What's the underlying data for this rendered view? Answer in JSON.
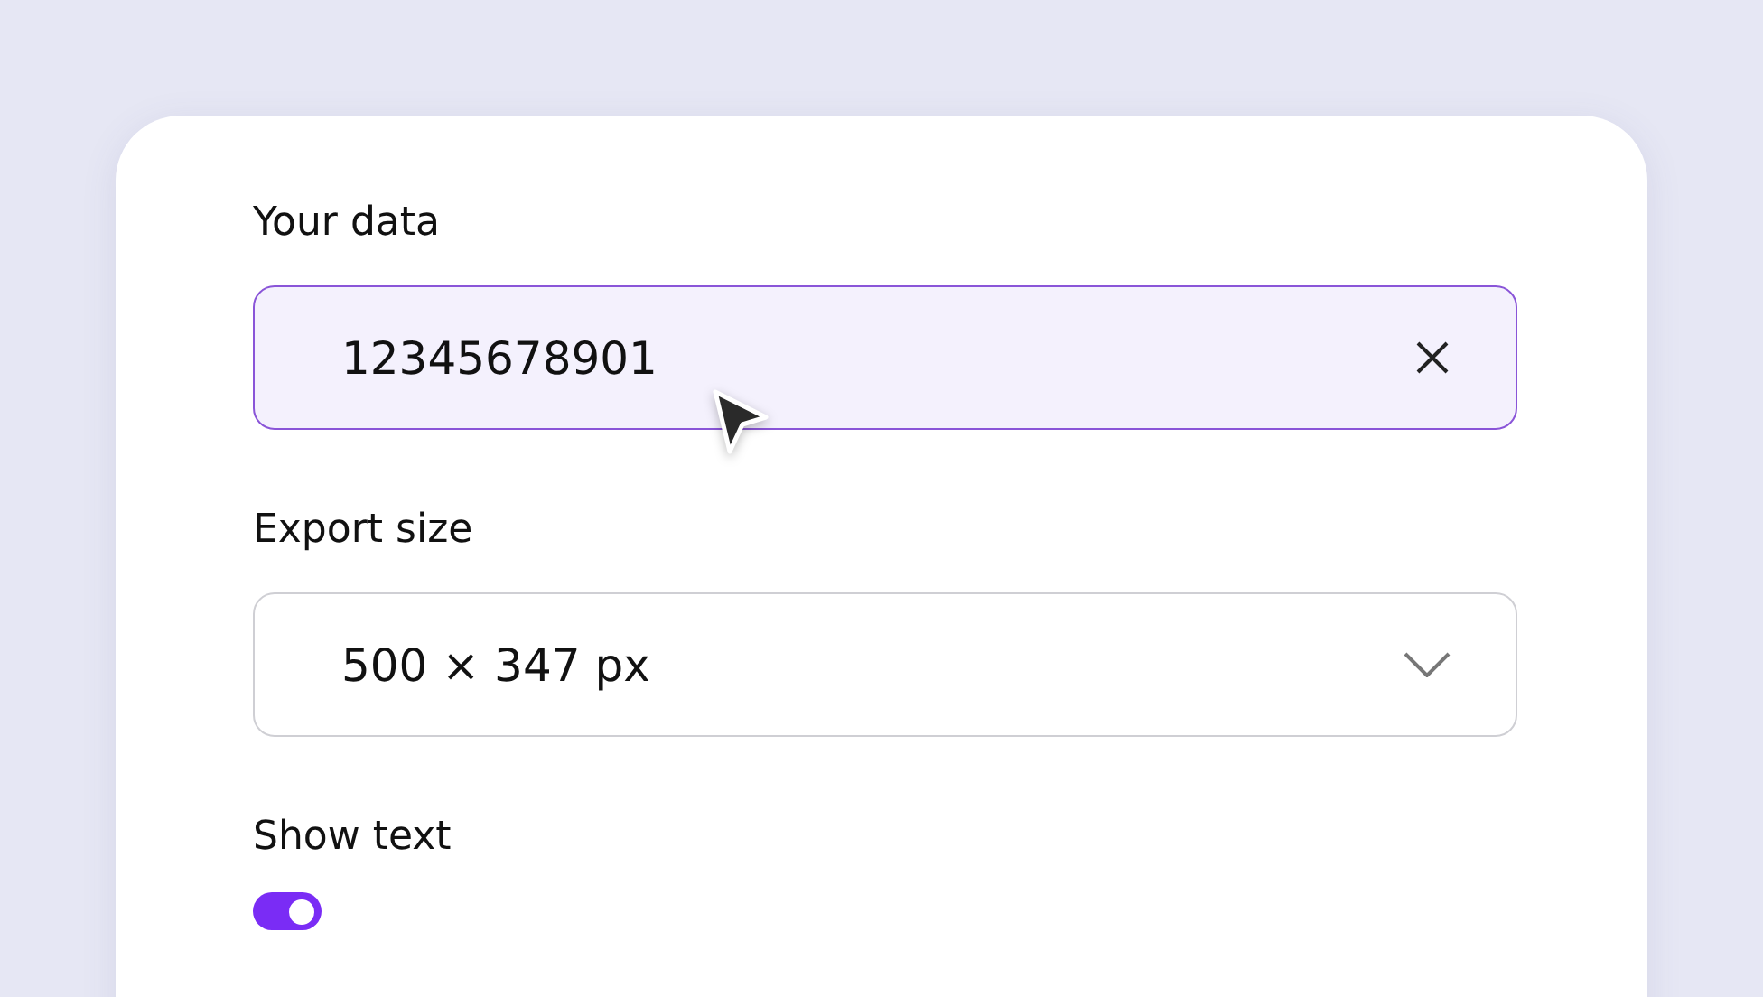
{
  "data_field": {
    "label": "Your data",
    "value": "12345678901",
    "focused": true
  },
  "export_size": {
    "label": "Export size",
    "value": "500 × 347 px"
  },
  "show_text": {
    "label": "Show text",
    "on": true
  }
}
